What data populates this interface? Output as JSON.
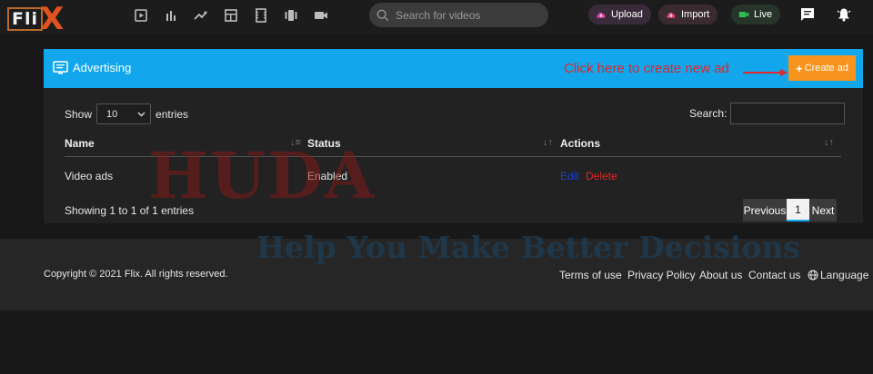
{
  "brand": {
    "logo_left": "Fli",
    "logo_right": "X"
  },
  "search": {
    "placeholder": "Search for videos"
  },
  "header_actions": {
    "upload": "Upload",
    "import": "Import",
    "live": "Live"
  },
  "panel": {
    "title": "Advertising",
    "annotation": "Click here to create new ad",
    "create_button": "Create ad"
  },
  "table_controls": {
    "show_label": "Show",
    "entries_value": "10",
    "entries_label": "entries",
    "search_label": "Search:"
  },
  "table": {
    "columns": [
      "Name",
      "Status",
      "Actions"
    ],
    "rows": [
      {
        "name": "Video ads",
        "status": "Enabled",
        "edit": "Edit",
        "delete": "Delete"
      }
    ]
  },
  "info": "Showing 1 to 1 of 1 entries",
  "pagination": {
    "previous": "Previous",
    "current": "1",
    "next": "Next"
  },
  "watermark": {
    "line1": "HUDA",
    "line2": "Help You Make Better Decisions"
  },
  "footer": {
    "copyright": "Copyright © 2021 Flix. All rights reserved.",
    "links": [
      "Terms of use",
      "Privacy Policy",
      "About us",
      "Contact us"
    ],
    "language": "Language"
  },
  "colors": {
    "header_blue": "#12a6ec",
    "create_orange": "#f7941d",
    "annotation_red": "#e0262a",
    "edit_blue": "#1a3fd6",
    "delete_red": "#e0262a"
  }
}
